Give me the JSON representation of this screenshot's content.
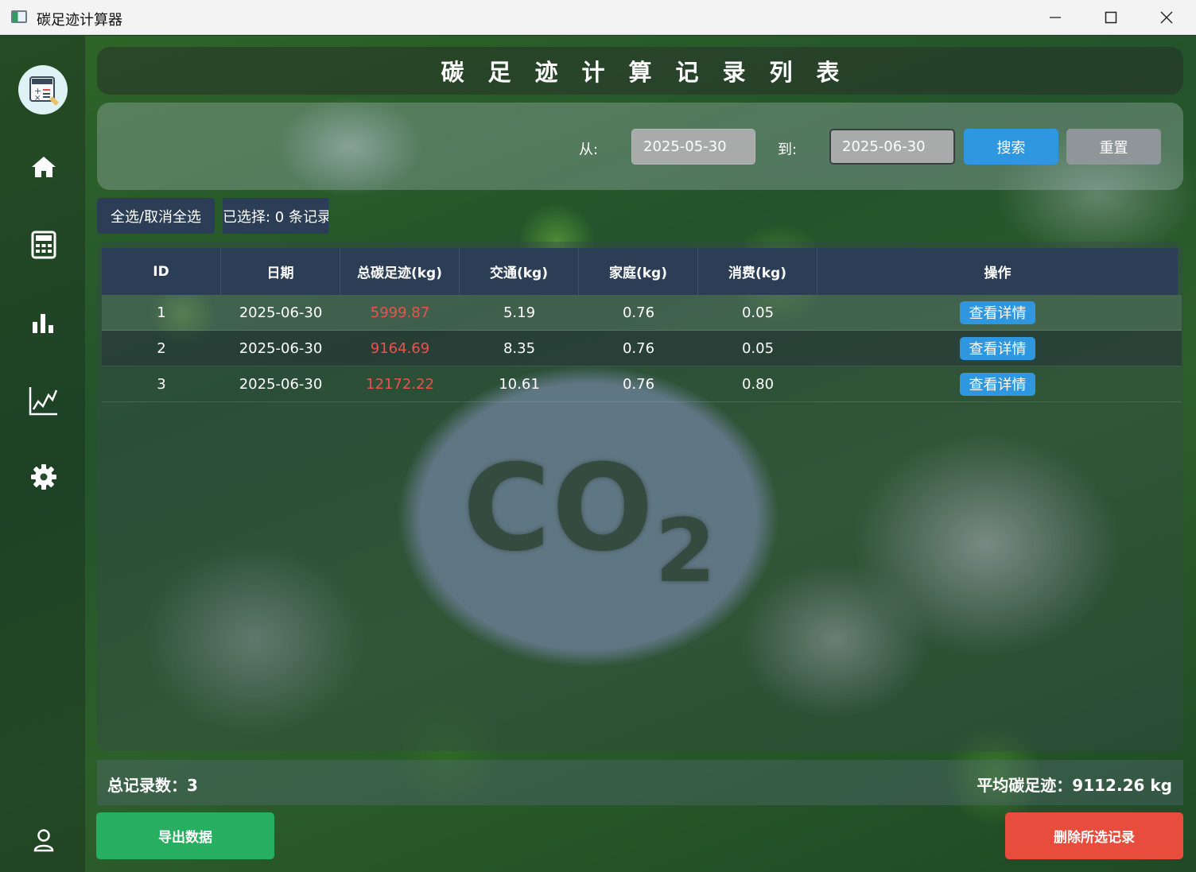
{
  "window": {
    "title": "碳足迹计算器"
  },
  "sidebar": {
    "items": [
      {
        "name": "home-icon"
      },
      {
        "name": "calculator-icon"
      },
      {
        "name": "bar-chart-icon"
      },
      {
        "name": "line-chart-icon"
      },
      {
        "name": "settings-icon"
      },
      {
        "name": "user-icon"
      }
    ]
  },
  "header": {
    "title": "碳足迹计算记录列表"
  },
  "filter": {
    "from_label": "从:",
    "from_value": "2025-05-30",
    "to_label": "到:",
    "to_value": "2025-06-30",
    "search_label": "搜索",
    "reset_label": "重置"
  },
  "selection": {
    "toggle_all_label": "全选/取消全选",
    "selected_text": "已选择: 0 条记录"
  },
  "table": {
    "columns": [
      "ID",
      "日期",
      "总碳足迹(kg)",
      "交通(kg)",
      "家庭(kg)",
      "消费(kg)",
      "操作"
    ],
    "rows": [
      {
        "id": "1",
        "date": "2025-06-30",
        "total": "5999.87",
        "transport": "5.19",
        "home": "0.76",
        "consumption": "0.05",
        "action": "查看详情"
      },
      {
        "id": "2",
        "date": "2025-06-30",
        "total": "9164.69",
        "transport": "8.35",
        "home": "0.76",
        "consumption": "0.05",
        "action": "查看详情"
      },
      {
        "id": "3",
        "date": "2025-06-30",
        "total": "12172.22",
        "transport": "10.61",
        "home": "0.76",
        "consumption": "0.80",
        "action": "查看详情"
      }
    ]
  },
  "summary": {
    "total_records": "总记录数：3",
    "average": "平均碳足迹：9112.26 kg"
  },
  "actions": {
    "export_label": "导出数据",
    "delete_label": "删除所选记录"
  },
  "background": {
    "label": "CO",
    "subscript": "2"
  },
  "colors": {
    "accent": "#2f97e0",
    "header": "#2c3e55",
    "export": "#27ae60",
    "delete": "#e74c3c",
    "total_text": "#e9534b"
  }
}
